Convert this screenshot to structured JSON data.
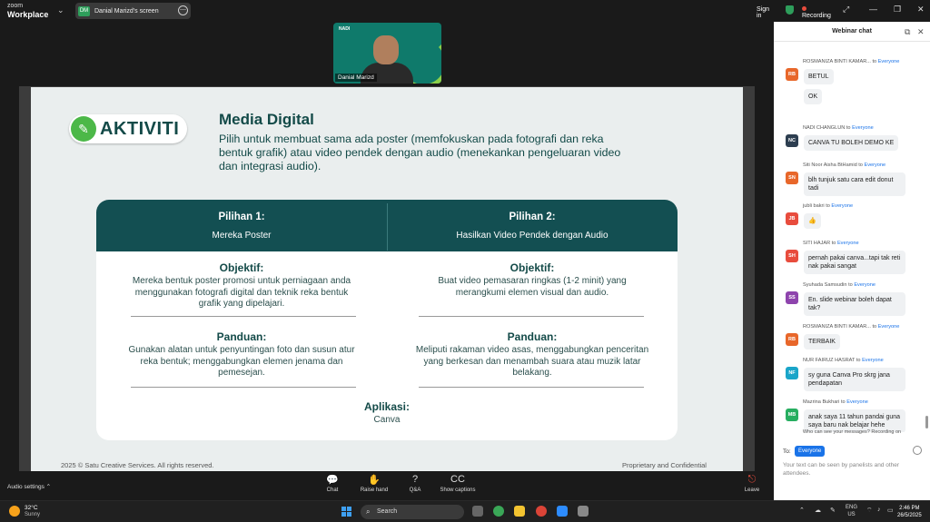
{
  "topbar": {
    "brand_small": "zoom",
    "brand_big": "Workplace",
    "share_badge": "DM",
    "share_label": "Danial Marizd's screen",
    "sign_in": "Sign in",
    "recording": "Recording"
  },
  "video": {
    "logos": "NADI",
    "name": "Danial Marizd"
  },
  "slide": {
    "badge": "AKTIVITI",
    "title": "Media Digital",
    "desc": "Pilih untuk membuat sama ada poster (memfokuskan pada fotografi dan reka bentuk grafik) atau video pendek dengan audio (menekankan pengeluaran video dan integrasi audio).",
    "opt1_title": "Pilihan 1:",
    "opt1_sub": "Mereka Poster",
    "opt2_title": "Pilihan 2:",
    "opt2_sub": "Hasilkan Video Pendek dengan Audio",
    "obj_label": "Objektif:",
    "obj1": "Mereka bentuk poster promosi untuk perniagaan anda menggunakan fotografi digital dan teknik reka bentuk grafik yang dipelajari.",
    "obj2": "Buat video pemasaran ringkas (1-2 minit) yang merangkumi elemen visual dan audio.",
    "pan_label": "Panduan:",
    "pan1": "Gunakan alatan untuk penyuntingan foto dan susun atur reka bentuk; menggabungkan elemen jenama dan pemesejan.",
    "pan2": "Meliputi rakaman video asas, menggabungkan penceritan yang berkesan dan menambah suara atau muzik latar belakang.",
    "app_label": "Aplikasi:",
    "app_value": "Canva",
    "footer_left": "2025 © Satu Creative Services. All rights reserved.",
    "footer_right": "Proprietary and Confidential"
  },
  "chat": {
    "title": "Webinar chat",
    "to_word": "to",
    "everyone": "Everyone",
    "messages": [
      {
        "initials": "RB",
        "color": "#e8672a",
        "sender": "ROSMANIZA BINTI KAMAR...",
        "texts": [
          "BETUL",
          "OK"
        ]
      },
      {
        "initials": "NC",
        "color": "#2d3e50",
        "sender": "NADI CHANGLUN",
        "texts": [
          "CANVA TU BOLEH DEMO KE"
        ]
      },
      {
        "initials": "SN",
        "color": "#e8672a",
        "sender": "Siti Noor Aisha BtHamid",
        "texts": [
          "blh tunjuk satu cara edit donut tadi"
        ]
      },
      {
        "initials": "JB",
        "color": "#e84c3d",
        "sender": "jubli bakri",
        "texts": [
          "👍"
        ]
      },
      {
        "initials": "SH",
        "color": "#e84c3d",
        "sender": "SITI HAJAR",
        "texts": [
          "pernah pakai canva...tapi tak reti nak pakai sangat"
        ]
      },
      {
        "initials": "SS",
        "color": "#8e44ad",
        "sender": "Syuhada Samsudin",
        "texts": [
          "En. slide webinar boleh dapat tak?"
        ]
      },
      {
        "initials": "RB",
        "color": "#e8672a",
        "sender": "ROSMANIZA BINTI KAMAR...",
        "texts": [
          "TERBAIK"
        ]
      },
      {
        "initials": "NF",
        "color": "#1aa5c9",
        "sender": "NUR FAIRUZ HASRAT",
        "texts": [
          "sy guna Canva Pro skrg jana pendapatan"
        ]
      },
      {
        "initials": "MB",
        "color": "#27ae60",
        "sender": "Mazrina Bukhari",
        "texts": [
          "anak saya 11 tahun pandai guna saya baru nak belajar hehe"
        ]
      }
    ],
    "privacy": "Who can see your messages? Recording on",
    "to_label": "To:",
    "to_value": "Everyone",
    "hint": "Your text can be seen by panelists and other attendees."
  },
  "toolbar": {
    "audio": "Audio settings",
    "chat": "Chat",
    "raise": "Raise hand",
    "qa": "Q&A",
    "captions": "Show captions",
    "leave": "Leave"
  },
  "taskbar": {
    "temp": "32°C",
    "cond": "Sunny",
    "search": "Search",
    "lang1": "ENG",
    "lang2": "US",
    "time": "2:46 PM",
    "date": "26/5/2025"
  }
}
